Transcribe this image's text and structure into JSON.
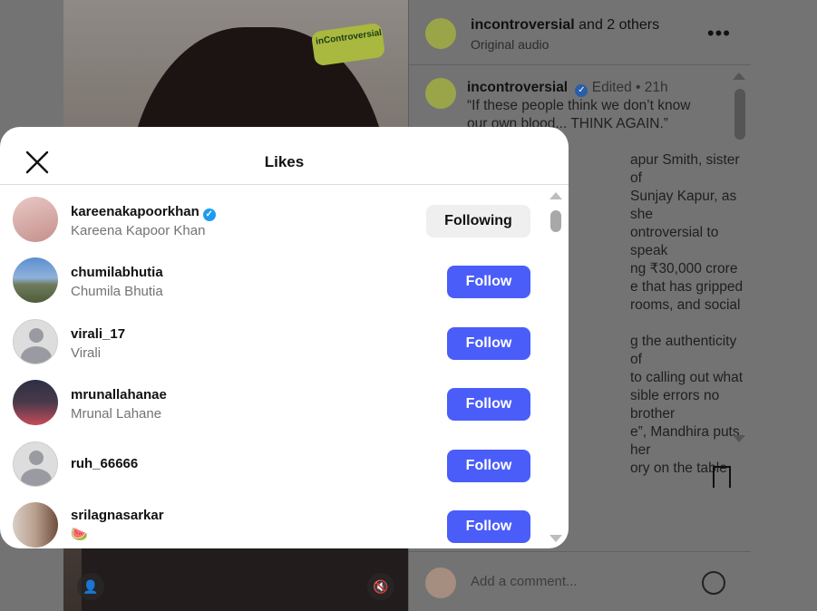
{
  "background": {
    "overlay_logo": "inControversial",
    "header": {
      "account": "incontroversial",
      "others": "and 2 others",
      "audio": "Original audio"
    },
    "post": {
      "author": "incontroversial",
      "edited": "Edited",
      "age": "21h",
      "caption_lines": [
        "“If these people think we don’t know",
        "our own blood... THINK AGAIN.”",
        "",
        "apur Smith, sister of",
        "Sunjay Kapur, as she",
        "ontroversial to speak",
        "ng ₹30,000 crore",
        "e that has gripped",
        "rooms, and social",
        "",
        "g the authenticity of",
        "to calling out what",
        "sible errors no brother",
        "e”, Mandhira puts her",
        "ory on the table"
      ]
    },
    "comment_placeholder": "Add a comment..."
  },
  "modal": {
    "title": "Likes",
    "users": [
      {
        "username": "kareenakapoorkhan",
        "fullname": "Kareena Kapoor Khan",
        "verified": true,
        "button": "Following"
      },
      {
        "username": "chumilabhutia",
        "fullname": "Chumila Bhutia",
        "verified": false,
        "button": "Follow"
      },
      {
        "username": "virali_17",
        "fullname": "Virali",
        "verified": false,
        "button": "Follow"
      },
      {
        "username": "mrunallahanae",
        "fullname": "Mrunal Lahane",
        "verified": false,
        "button": "Follow"
      },
      {
        "username": "ruh_66666",
        "fullname": "",
        "verified": false,
        "button": "Follow"
      },
      {
        "username": "srilagnasarkar",
        "fullname": "🍉",
        "verified": false,
        "button": "Follow"
      }
    ]
  },
  "colors": {
    "follow_button": "#4a5df9",
    "following_button": "#efefef",
    "verified_badge": "#1d9bf0"
  }
}
